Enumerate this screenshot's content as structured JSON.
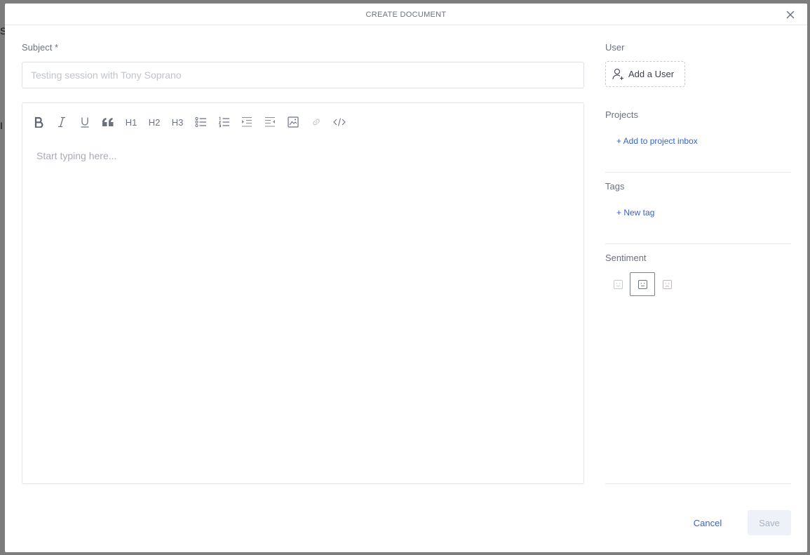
{
  "background": {
    "peek_1": "S",
    "peek_2": "I"
  },
  "modal": {
    "title": "CREATE DOCUMENT"
  },
  "subject": {
    "label": "Subject *",
    "placeholder": "Testing session with Tony Soprano",
    "value": ""
  },
  "toolbar": {
    "h1": "H1",
    "h2": "H2",
    "h3": "H3",
    "icons": [
      "bold-icon",
      "italic-icon",
      "underline-icon",
      "quote-icon",
      "h1",
      "h2",
      "h3",
      "bullet-list-icon",
      "numbered-list-icon",
      "indent-icon",
      "outdent-icon",
      "image-icon",
      "link-icon",
      "code-icon"
    ]
  },
  "editor": {
    "placeholder": "Start typing here..."
  },
  "sidebar": {
    "user_label": "User",
    "add_user": "Add a User",
    "projects_label": "Projects",
    "add_project": "+ Add to project inbox",
    "tags_label": "Tags",
    "new_tag": "+ New tag",
    "sentiment_label": "Sentiment",
    "sentiment_selected": "neutral"
  },
  "footer": {
    "cancel": "Cancel",
    "save": "Save"
  },
  "colors": {
    "accent": "#3a62c9",
    "positive": "#a8d8cf",
    "neutral": "#6b7280",
    "negative": "#f0a3ae",
    "save_bg": "#eef1f7"
  }
}
